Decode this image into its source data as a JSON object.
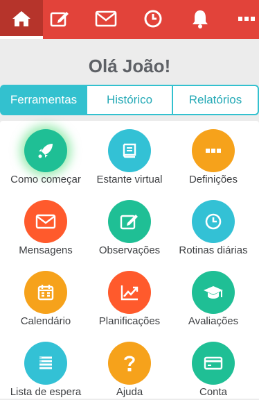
{
  "nav": {
    "items": [
      {
        "icon": "home-icon",
        "active": true
      },
      {
        "icon": "edit-icon"
      },
      {
        "icon": "mail-icon"
      },
      {
        "icon": "clock-icon"
      },
      {
        "icon": "bell-icon"
      },
      {
        "icon": "more-icon"
      }
    ]
  },
  "greeting": "Olá João!",
  "tabs": [
    "Ferramentas",
    "Histórico",
    "Relatórios"
  ],
  "tiles": [
    {
      "label": "Como começar",
      "icon": "rocket-icon",
      "color": "#1fbf95"
    },
    {
      "label": "Estante virtual",
      "icon": "book-icon",
      "color": "#33c1d5"
    },
    {
      "label": "Definições",
      "icon": "more-icon",
      "color": "#f6a21b"
    },
    {
      "label": "Mensagens",
      "icon": "mail-icon",
      "color": "#ff5a2c"
    },
    {
      "label": "Observações",
      "icon": "edit-icon",
      "color": "#1fbf95"
    },
    {
      "label": "Rotinas diárias",
      "icon": "clock-icon",
      "color": "#33c1d5"
    },
    {
      "label": "Calendário",
      "icon": "calendar-icon",
      "color": "#f6a21b"
    },
    {
      "label": "Planificações",
      "icon": "chart-icon",
      "color": "#ff5a2c"
    },
    {
      "label": "Avaliações",
      "icon": "graduation-cap-icon",
      "color": "#1fbf95"
    },
    {
      "label": "Lista de espera",
      "icon": "list-icon",
      "color": "#33c1d5"
    },
    {
      "label": "Ajuda",
      "icon": "question-icon",
      "color": "#f6a21b"
    },
    {
      "label": "Conta",
      "icon": "credit-card-icon",
      "color": "#1fbf95"
    }
  ]
}
